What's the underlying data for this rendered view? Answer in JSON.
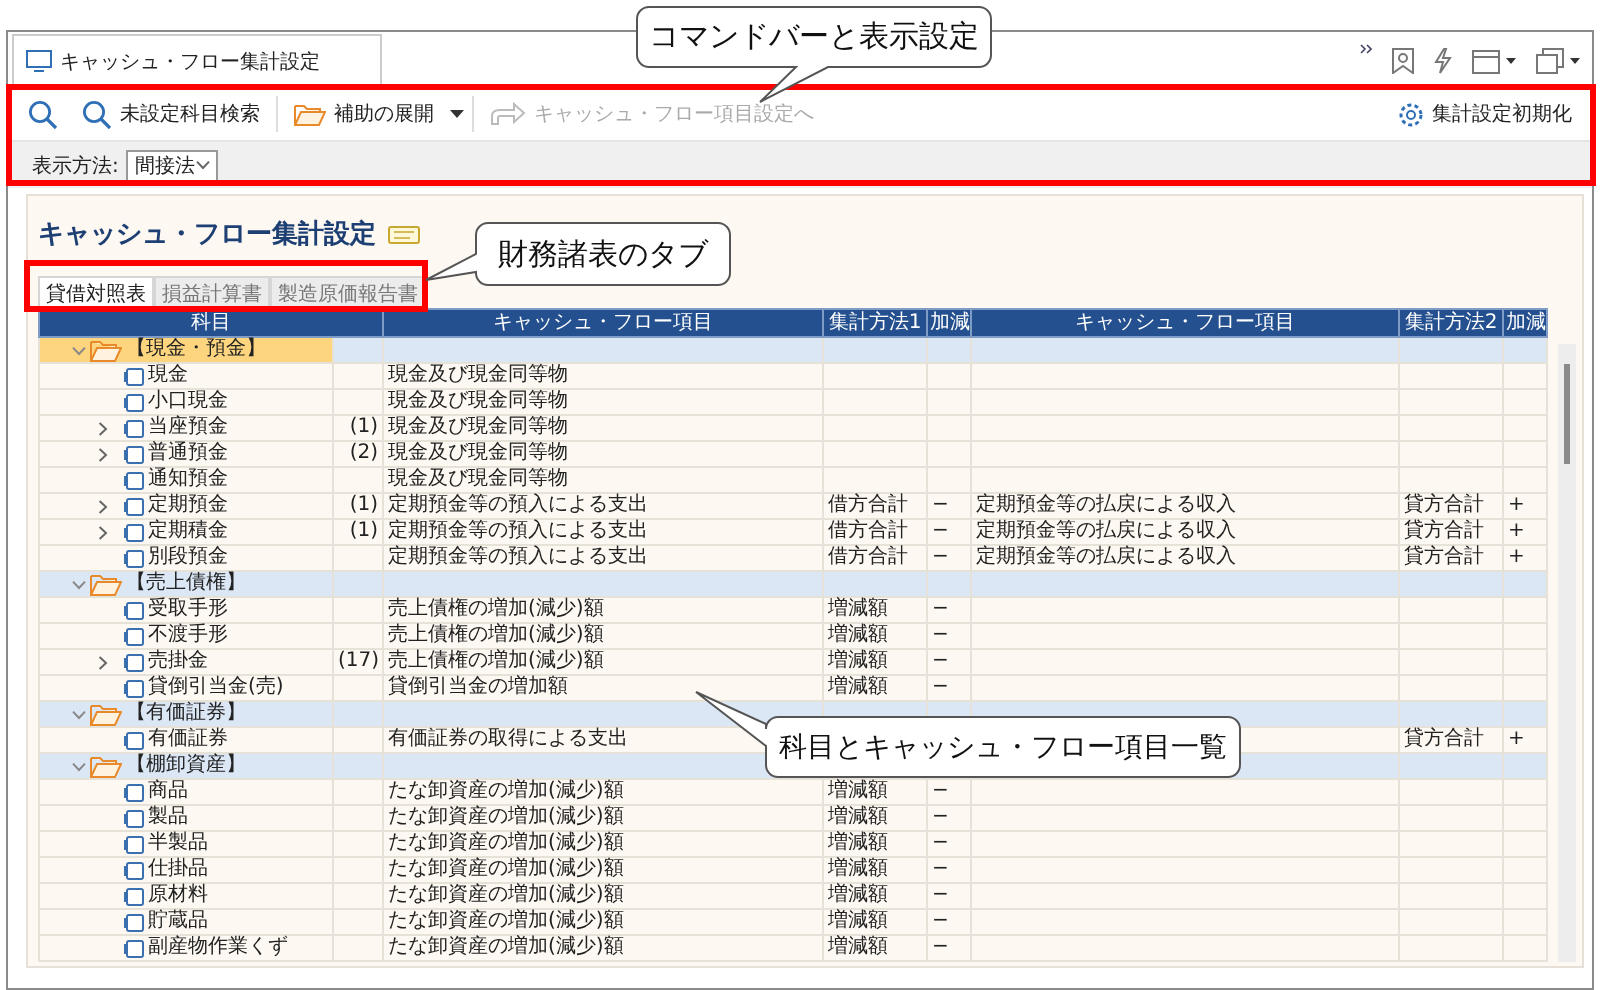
{
  "window_tab": {
    "title": "キャッシュ・フロー集計設定"
  },
  "command_bar": {
    "items": [
      {
        "kind": "search",
        "label": "未設定科目検索",
        "disabled": false
      },
      {
        "kind": "expand",
        "label": "補助の展開",
        "disabled": false
      },
      {
        "kind": "jump",
        "label": "キャッシュ・フロー項目設定へ",
        "disabled": true
      }
    ],
    "reset_button": {
      "label": "集計設定初期化"
    }
  },
  "display": {
    "label": "表示方法:",
    "value": "間接法"
  },
  "title": "キャッシュ・フロー集計設定",
  "statement_tabs": [
    {
      "label": "貸借対照表",
      "selected": true
    },
    {
      "label": "損益計算書",
      "selected": false
    },
    {
      "label": "製造原価報告書",
      "selected": false
    }
  ],
  "table": {
    "columns": [
      "科目",
      "キャッシュ・フロー項目",
      "集計方法1",
      "加減",
      "キャッシュ・フロー項目",
      "集計方法2",
      "加減"
    ],
    "groups": [
      {
        "name": "【現金・預金】",
        "selected": true,
        "expanded": true,
        "children": [
          {
            "name": "現金",
            "cf_item_1": "現金及び現金同等物"
          },
          {
            "name": "小口現金",
            "cf_item_1": "現金及び現金同等物"
          },
          {
            "name": "当座預金",
            "expanded": false,
            "prefix": "(1)",
            "cf_item_1": "現金及び現金同等物"
          },
          {
            "name": "普通預金",
            "expanded": false,
            "prefix": "(2)",
            "cf_item_1": "現金及び現金同等物"
          },
          {
            "name": "通知預金",
            "cf_item_1": "現金及び現金同等物"
          },
          {
            "name": "定期預金",
            "expanded": false,
            "prefix": "(1)",
            "cf_item_1": "定期預金等の預入による支出",
            "method_1": "借方合計",
            "sign_1": "−",
            "cf_item_2": "定期預金等の払戻による収入",
            "method_2": "貸方合計",
            "sign_2": "+"
          },
          {
            "name": "定期積金",
            "expanded": false,
            "prefix": "(1)",
            "cf_item_1": "定期預金等の預入による支出",
            "method_1": "借方合計",
            "sign_1": "−",
            "cf_item_2": "定期預金等の払戻による収入",
            "method_2": "貸方合計",
            "sign_2": "+"
          },
          {
            "name": "別段預金",
            "cf_item_1": "定期預金等の預入による支出",
            "method_1": "借方合計",
            "sign_1": "−",
            "cf_item_2": "定期預金等の払戻による収入",
            "method_2": "貸方合計",
            "sign_2": "+"
          }
        ]
      },
      {
        "name": "【売上債権】",
        "selected": false,
        "expanded": true,
        "children": [
          {
            "name": "受取手形",
            "cf_item_1": "売上債権の増加(減少)額",
            "method_1": "増減額",
            "sign_1": "−"
          },
          {
            "name": "不渡手形",
            "cf_item_1": "売上債権の増加(減少)額",
            "method_1": "増減額",
            "sign_1": "−"
          },
          {
            "name": "売掛金",
            "expanded": false,
            "prefix": "(17)",
            "cf_item_1": "売上債権の増加(減少)額",
            "method_1": "増減額",
            "sign_1": "−"
          },
          {
            "name": "貸倒引当金(売)",
            "cf_item_1": "貸倒引当金の増加額",
            "method_1": "増減額",
            "sign_1": "−"
          }
        ]
      },
      {
        "name": "【有価証券】",
        "selected": false,
        "expanded": true,
        "children": [
          {
            "name": "有価証券",
            "cf_item_1": "有価証券の取得による支出",
            "method_2": "貸方合計",
            "sign_2": "+"
          }
        ]
      },
      {
        "name": "【棚卸資産】",
        "selected": false,
        "expanded": true,
        "children": [
          {
            "name": "商品",
            "cf_item_1": "たな卸資産の増加(減少)額",
            "method_1": "増減額",
            "sign_1": "−"
          },
          {
            "name": "製品",
            "cf_item_1": "たな卸資産の増加(減少)額",
            "method_1": "増減額",
            "sign_1": "−"
          },
          {
            "name": "半製品",
            "cf_item_1": "たな卸資産の増加(減少)額",
            "method_1": "増減額",
            "sign_1": "−"
          },
          {
            "name": "仕掛品",
            "cf_item_1": "たな卸資産の増加(減少)額",
            "method_1": "増減額",
            "sign_1": "−"
          },
          {
            "name": "原材料",
            "cf_item_1": "たな卸資産の増加(減少)額",
            "method_1": "増減額",
            "sign_1": "−"
          },
          {
            "name": "貯蔵品",
            "cf_item_1": "たな卸資産の増加(減少)額",
            "method_1": "増減額",
            "sign_1": "−"
          },
          {
            "name": "副産物作業くず",
            "cf_item_1": "たな卸資産の増加(減少)額",
            "method_1": "増減額",
            "sign_1": "−"
          }
        ]
      }
    ]
  },
  "callouts": [
    {
      "text": "コマンドバーと表示設定"
    },
    {
      "text": "財務諸表のタブ"
    },
    {
      "text": "科目とキャッシュ・フロー項目一覧"
    }
  ]
}
